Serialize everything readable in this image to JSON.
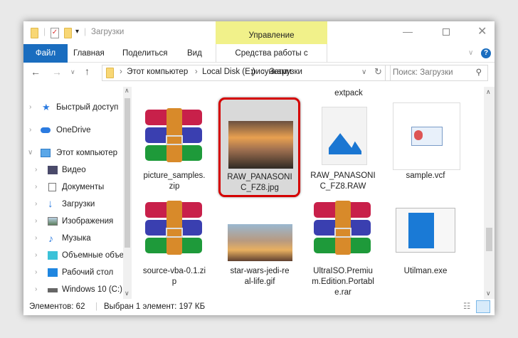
{
  "window": {
    "title": "Загрузки",
    "context_group": "Управление"
  },
  "ribbon": {
    "tabs": [
      "Файл",
      "Главная",
      "Поделиться",
      "Вид",
      "Средства работы с рисунками"
    ]
  },
  "address": {
    "crumbs": [
      "Этот компьютер",
      "Local Disk (E:)",
      "Загрузки"
    ],
    "search_placeholder": "Поиск: Загрузки"
  },
  "sidebar": {
    "items": [
      {
        "label": "Быстрый доступ",
        "icon": "star-icon"
      },
      {
        "label": "OneDrive",
        "icon": "cloud-icon"
      },
      {
        "label": "Этот компьютер",
        "icon": "computer-icon"
      },
      {
        "label": "Видео",
        "icon": "video-icon"
      },
      {
        "label": "Документы",
        "icon": "documents-icon"
      },
      {
        "label": "Загрузки",
        "icon": "download-icon"
      },
      {
        "label": "Изображения",
        "icon": "pictures-icon"
      },
      {
        "label": "Музыка",
        "icon": "music-icon"
      },
      {
        "label": "Объемные объекты",
        "icon": "3d-objects-icon"
      },
      {
        "label": "Рабочий стол",
        "icon": "desktop-icon"
      },
      {
        "label": "Windows 10 (C:)",
        "icon": "drive-icon"
      }
    ]
  },
  "files": {
    "partial_label": "extpack",
    "items": [
      {
        "name": "picture_samples.zip",
        "lines": [
          "picture_samples.",
          "zip"
        ]
      },
      {
        "name": "RAW_PANASONIC_FZ8.jpg",
        "lines": [
          "RAW_PANASONI",
          "C_FZ8.jpg"
        ]
      },
      {
        "name": "RAW_PANASONIC_FZ8.RAW",
        "lines": [
          "RAW_PANASONI",
          "C_FZ8.RAW"
        ]
      },
      {
        "name": "sample.vcf",
        "lines": [
          "sample.vcf"
        ]
      },
      {
        "name": "source-vba-0.1.zip",
        "lines": [
          "source-vba-0.1.zi",
          "p"
        ]
      },
      {
        "name": "star-wars-jedi-real-life.gif",
        "lines": [
          "star-wars-jedi-re",
          "al-life.gif"
        ]
      },
      {
        "name": "UltraISO.Premium.Edition.Portable.rar",
        "lines": [
          "UltraISO.Premiu",
          "m.Edition.Portabl",
          "e.rar"
        ]
      },
      {
        "name": "Utilman.exe",
        "lines": [
          "Utilman.exe"
        ]
      }
    ]
  },
  "status": {
    "count": "Элементов: 62",
    "selected": "Выбран 1 элемент: 197 КБ"
  },
  "colors": {
    "accent": "#1a6dbf",
    "context": "#f1f18a",
    "highlight": "#d50000"
  }
}
